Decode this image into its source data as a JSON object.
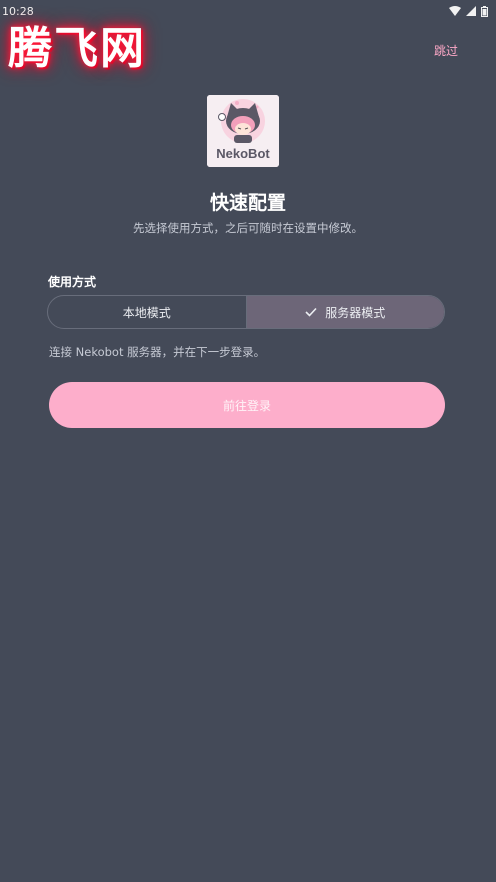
{
  "status_bar": {
    "time": "10:28",
    "icons": [
      "wifi-icon",
      "signal-icon",
      "battery-icon"
    ]
  },
  "watermark": {
    "text": "腾飞网"
  },
  "header": {
    "skip_label": "跳过"
  },
  "logo": {
    "text": "NekoBot"
  },
  "page": {
    "title": "快速配置",
    "subtitle": "先选择使用方式，之后可随时在设置中修改。"
  },
  "usage": {
    "label": "使用方式",
    "options": [
      {
        "label": "本地模式",
        "selected": false
      },
      {
        "label": "服务器模式",
        "selected": true
      }
    ],
    "description": "连接 Nekobot 服务器，并在下一步登录。"
  },
  "actions": {
    "primary_label": "前往登录"
  },
  "colors": {
    "background": "#444a58",
    "accent": "#fdaecb",
    "selected_segment": "#6d6678",
    "link": "#ffa9c8"
  }
}
